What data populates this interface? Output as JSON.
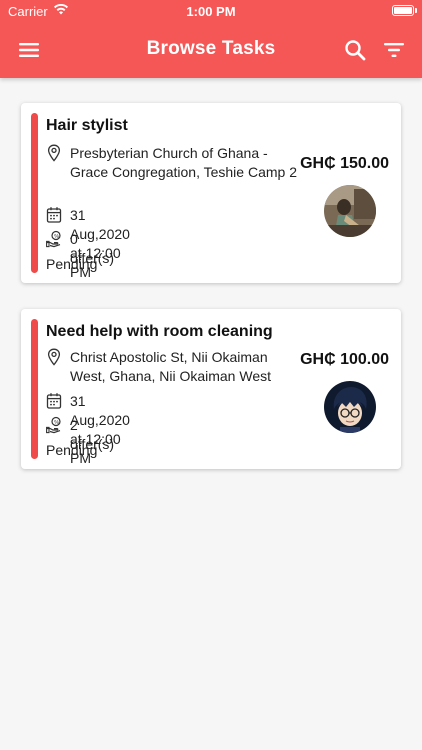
{
  "status_bar": {
    "carrier": "Carrier",
    "time": "1:00 PM"
  },
  "header": {
    "title": "Browse Tasks"
  },
  "colors": {
    "brand": "#f55656",
    "accent_bar": "#ef4b4b",
    "background": "#f6f6f6"
  },
  "icons": {
    "menu": "menu-icon",
    "search": "search-icon",
    "filter": "filter-icon",
    "location": "location-pin-icon",
    "calendar": "calendar-icon",
    "offers": "hand-coin-icon"
  },
  "tasks": [
    {
      "title": "Hair stylist",
      "address": "Presbyterian Church of Ghana - Grace Congregation, Teshie Camp 2",
      "datetime": "31 Aug,2020 at 12:00 PM",
      "offers": "0 offer(s)",
      "status": "Pending",
      "price": "GH₵ 150.00"
    },
    {
      "title": "Need help with room cleaning",
      "address": "Christ Apostolic St, Nii Okaiman West, Ghana, Nii Okaiman West",
      "datetime": "31 Aug,2020 at 12:00 PM",
      "offers": "2 offer(s)",
      "status": "Pending",
      "price": "GH₵ 100.00"
    }
  ]
}
